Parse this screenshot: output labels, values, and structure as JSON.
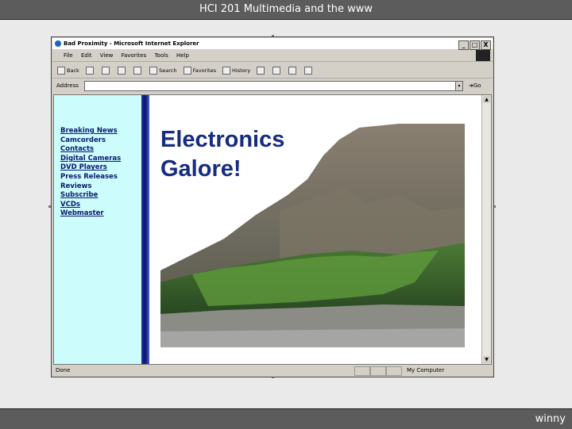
{
  "slide": {
    "title": "HCI 201 Multimedia and the www",
    "footer": "winny"
  },
  "browser": {
    "window_title": "Bad Proximity - Microsoft Internet Explorer",
    "window_buttons": [
      "_",
      "□",
      "X"
    ],
    "menu": [
      "File",
      "Edit",
      "View",
      "Favorites",
      "Tools",
      "Help"
    ],
    "toolbar": {
      "back": "Back",
      "search": "Search",
      "favorites": "Favorites",
      "history": "History"
    },
    "address_label": "Address",
    "address_value": "",
    "go_label": "Go",
    "status_text": "Done",
    "status_zone": "My Computer"
  },
  "page": {
    "nav_items": [
      "Breaking News",
      "Camcorders",
      "Contacts",
      "Digital Cameras",
      "DVD Players",
      "Press Releases",
      "Reviews",
      "Subscribe",
      "VCDs",
      "Webmaster"
    ],
    "headline_line1": "Electronics",
    "headline_line2": "Galore!"
  },
  "colors": {
    "nav_bg": "#ccfcfc",
    "stripe": "#0a1670",
    "headline": "#152c80"
  }
}
